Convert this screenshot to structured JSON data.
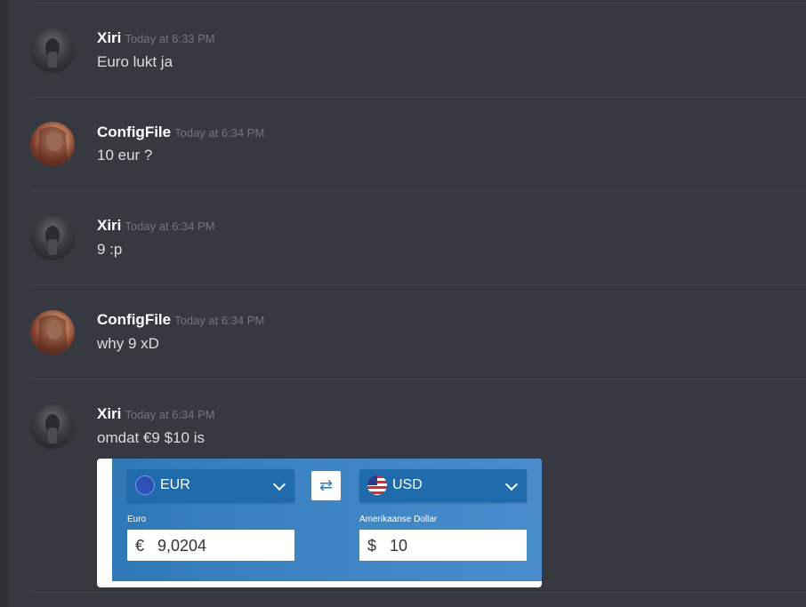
{
  "messages": [
    {
      "username": "Xiri",
      "timestamp": "Today at 6:33 PM",
      "text": "Euro lukt ja"
    },
    {
      "username": "ConfigFile",
      "timestamp": "Today at 6:34 PM",
      "text": "10 eur ?"
    },
    {
      "username": "Xiri",
      "timestamp": "Today at 6:34 PM",
      "text": "9 :p"
    },
    {
      "username": "ConfigFile",
      "timestamp": "Today at 6:34 PM",
      "text": "why 9 xD"
    },
    {
      "username": "Xiri",
      "timestamp": "Today at 6:34 PM",
      "text": "omdat €9 $10 is"
    }
  ],
  "converter": {
    "from_code": "EUR",
    "to_code": "USD",
    "from_label": "Euro",
    "to_label": "Amerikaanse Dollar",
    "from_symbol": "€",
    "to_symbol": "$",
    "from_value": "9,0204",
    "to_value": "10",
    "swap_glyph": "⇄"
  },
  "colors": {
    "background": "#36393f",
    "username": "#ffffff",
    "timestamp": "#72767d",
    "message_text": "#dcddde",
    "converter_blue": "#2f78b6"
  },
  "icons": {
    "from_flag": "eu-flag-icon",
    "to_flag": "us-flag-icon",
    "swap": "swap-arrows-icon",
    "dropdown": "chevron-down-icon"
  }
}
